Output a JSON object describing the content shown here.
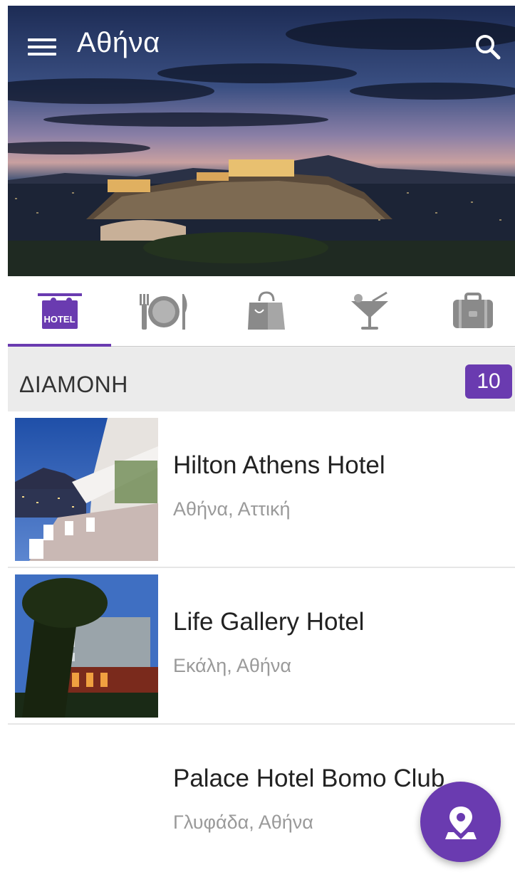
{
  "app": {
    "title": "Αθήνα"
  },
  "tabs": [
    {
      "id": "hotel",
      "icon": "hotel-sign-icon",
      "label": "HOTEL",
      "active": true
    },
    {
      "id": "food",
      "icon": "plate-cutlery-icon",
      "active": false
    },
    {
      "id": "shopping",
      "icon": "shopping-bag-icon",
      "active": false
    },
    {
      "id": "nightlife",
      "icon": "cocktail-icon",
      "active": false
    },
    {
      "id": "travel",
      "icon": "suitcase-icon",
      "active": false
    }
  ],
  "section": {
    "title": "ΔΙΑΜΟΝΗ",
    "count": "10"
  },
  "items": [
    {
      "name": "Hilton Athens Hotel",
      "location": "Αθήνα, Αττική",
      "image": "hotel-terrace-photo"
    },
    {
      "name": "Life Gallery Hotel",
      "location": "Εκάλη, Αθήνα",
      "image": "hotel-building-photo"
    },
    {
      "name": "Palace Hotel Bomo Club",
      "location": "Γλυφάδα, Αθήνα",
      "image": ""
    }
  ],
  "colors": {
    "accent": "#6a3bb0",
    "tab_inactive": "#8a8a8a",
    "section_bg": "#ebebeb"
  }
}
